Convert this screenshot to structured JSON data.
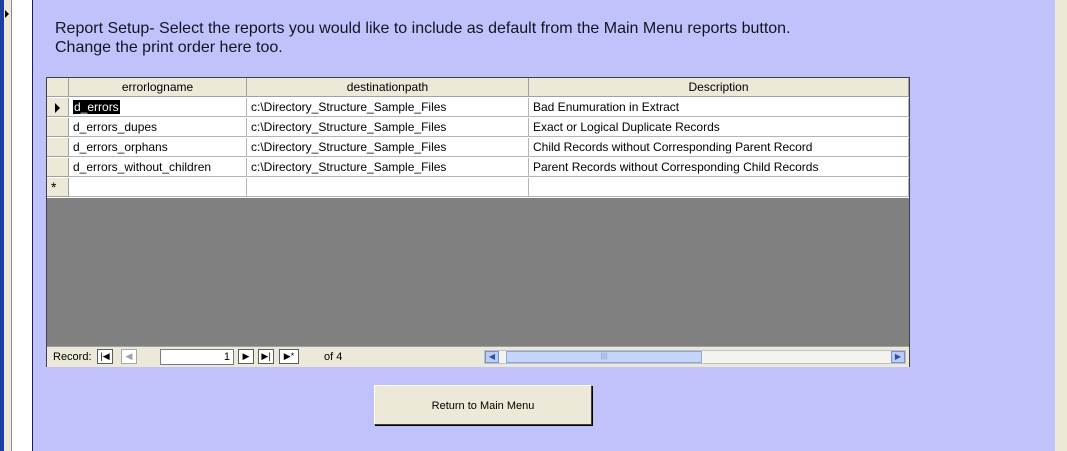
{
  "instructions": {
    "line1": "Report Setup- Select the reports you would like to include as default from the Main Menu reports button.",
    "line2": "Change the print order here too."
  },
  "grid": {
    "columns": [
      "errorlogname",
      "destinationpath",
      "Description"
    ],
    "rows": [
      [
        "d_errors",
        "c:\\Directory_Structure_Sample_Files",
        "Bad Enumuration in Extract"
      ],
      [
        "d_errors_dupes",
        "c:\\Directory_Structure_Sample_Files",
        "Exact or Logical Duplicate Records"
      ],
      [
        "d_errors_orphans",
        "c:\\Directory_Structure_Sample_Files",
        "Child Records without Corresponding Parent Record"
      ],
      [
        "d_errors_without_children",
        "c:\\Directory_Structure_Sample_Files",
        "Parent Records without Corresponding Child Records"
      ]
    ],
    "new_row_marker": "*",
    "current_row": "d_errors"
  },
  "navigation": {
    "record_label": "Record:",
    "current_record": "1",
    "total_text": "of 4",
    "first_icon": "first-record-icon",
    "prev_icon": "previous-record-icon",
    "next_icon": "next-record-icon",
    "last_icon": "last-record-icon",
    "new_icon": "new-record-icon"
  },
  "buttons": {
    "return_label": "Return to Main Menu"
  },
  "colors": {
    "form_background": "#c0c3fb",
    "datasheet_empty": "#808080",
    "accent": "#1f3fa0"
  }
}
